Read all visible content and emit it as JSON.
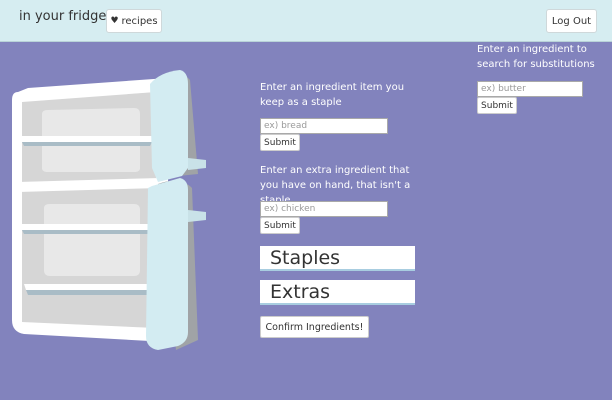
{
  "header": {
    "brand": "in your fridge",
    "recipes_icon": "heart-icon",
    "recipes_label": "recipes",
    "logout_label": "Log Out"
  },
  "staple": {
    "prompt": "Enter an ingredient item you keep as a staple",
    "placeholder": "ex) bread",
    "value": "",
    "submit_label": "Submit"
  },
  "extra": {
    "prompt": "Enter an extra ingredient that you have on hand, that isn't a staple",
    "placeholder": "ex) chicken",
    "value": "",
    "submit_label": "Submit"
  },
  "lists": {
    "staples_heading": "Staples",
    "extras_heading": "Extras"
  },
  "confirm_label": "Confirm Ingredients!",
  "substitution": {
    "prompt": "Enter an ingredient to search for substitutions",
    "placeholder": "ex) butter",
    "value": "",
    "submit_label": "Submit"
  },
  "colors": {
    "background": "#8283bd",
    "navbar": "#d6edf1",
    "fridge_door": "#d3ecf2",
    "fridge_body": "#d8d8d8"
  },
  "illustration": {
    "icon": "open-fridge-icon"
  }
}
